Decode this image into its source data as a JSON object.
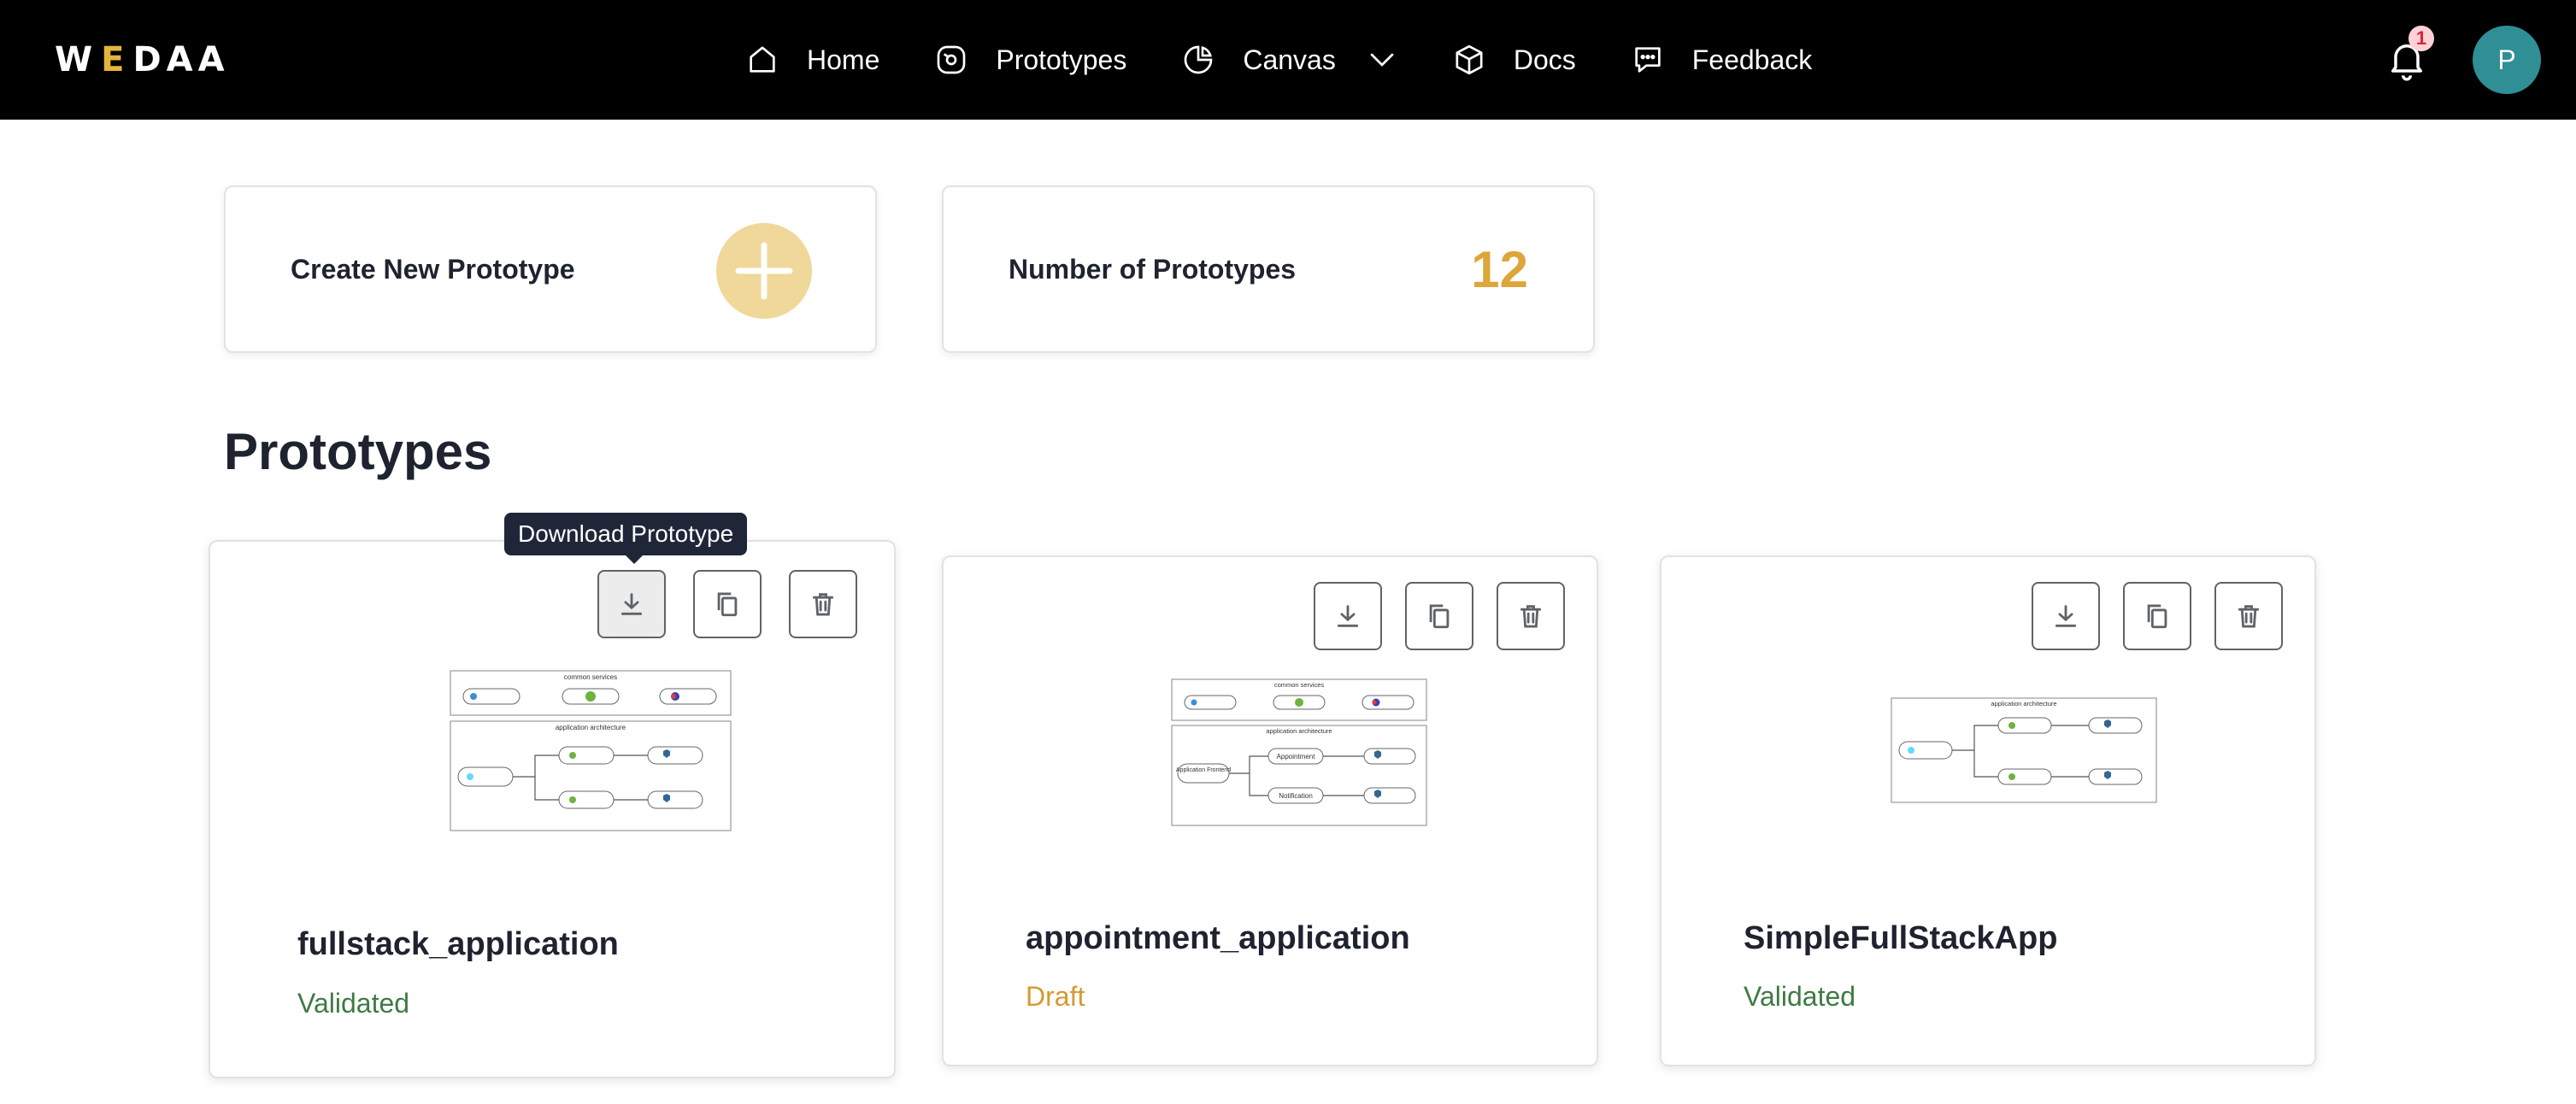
{
  "header": {
    "logo": {
      "pre": "W",
      "accent": "E",
      "post": "DAA"
    },
    "nav": [
      {
        "label": "Home",
        "icon": "home-icon"
      },
      {
        "label": "Prototypes",
        "icon": "prototypes-icon"
      },
      {
        "label": "Canvas",
        "icon": "canvas-icon"
      },
      {
        "label": "Docs",
        "icon": "docs-icon"
      },
      {
        "label": "Feedback",
        "icon": "feedback-icon"
      }
    ],
    "notifications_count": "1",
    "avatar_initial": "P"
  },
  "summary": {
    "create_label": "Create New Prototype",
    "count_label": "Number of Prototypes",
    "count_value": "12"
  },
  "section_title": "Prototypes",
  "tooltip": "Download Prototype",
  "prototypes": [
    {
      "name": "fullstack_application",
      "status": "Validated"
    },
    {
      "name": "appointment_application",
      "status": "Draft"
    },
    {
      "name": "SimpleFullStackApp",
      "status": "Validated"
    }
  ],
  "thumbnails": {
    "common_services": "common services",
    "application_architecture": "application architecture",
    "appointment_nodes": [
      "Application Frontend",
      "Appointment",
      "Notification"
    ]
  },
  "colors": {
    "topbar": "#000000",
    "accent_gold": "#dca63a",
    "plus_circle": "#f0d79a",
    "validated": "#3f7a44",
    "draft": "#d59a2f",
    "avatar": "#2f8f94"
  }
}
